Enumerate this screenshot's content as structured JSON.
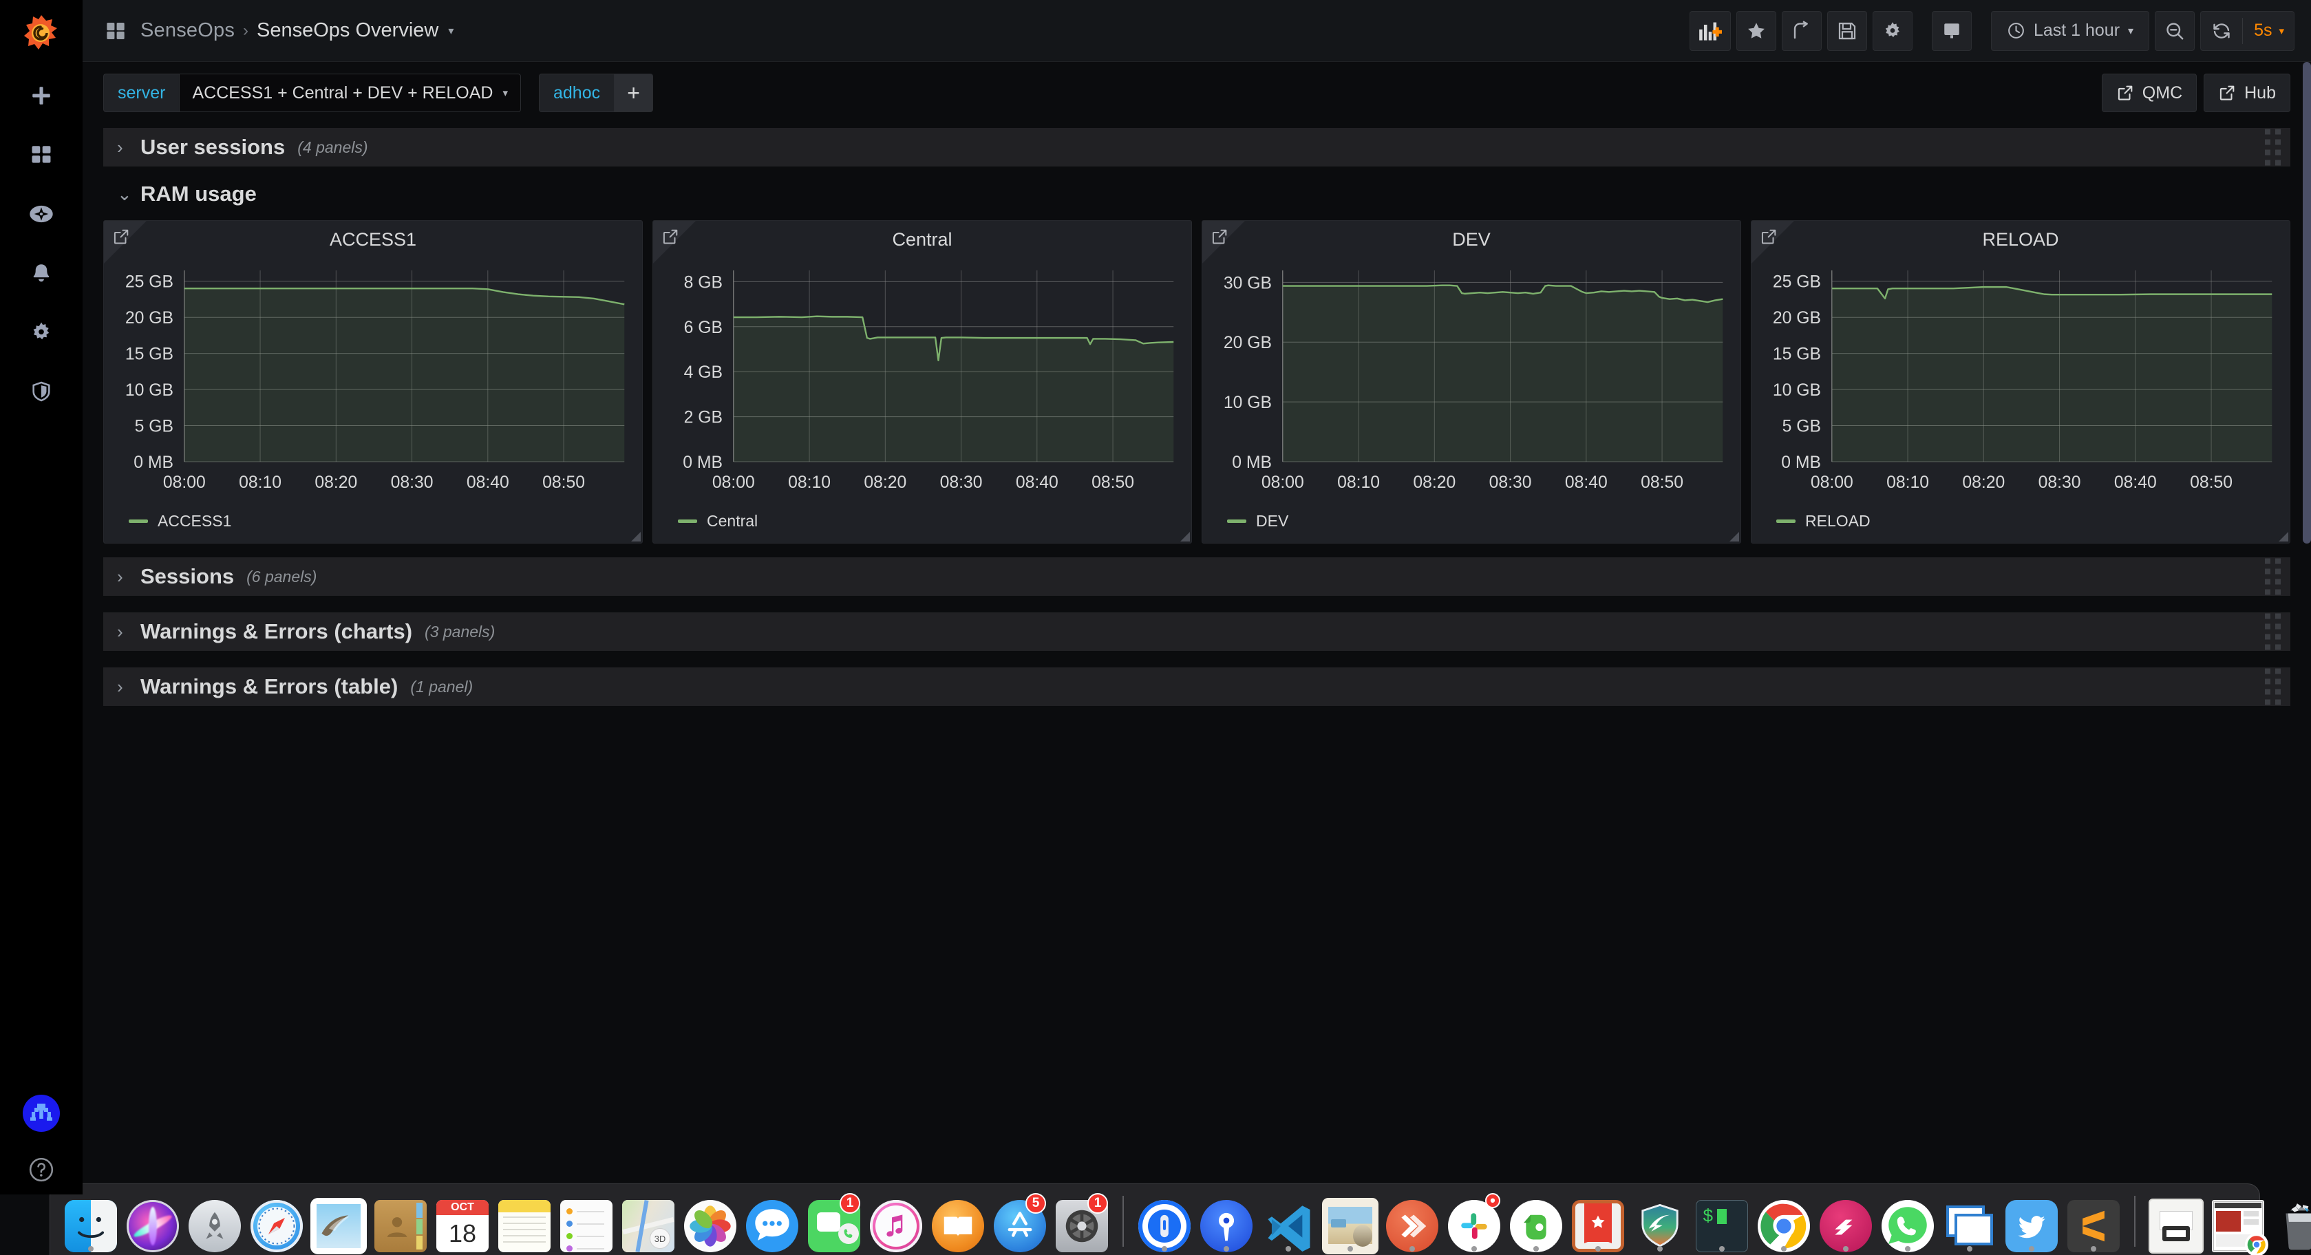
{
  "app": {
    "name": "Grafana",
    "logo_icon": "grafana-logo-icon"
  },
  "sidebar": {
    "items": [
      {
        "name": "create",
        "icon": "plus-icon",
        "label": "Create"
      },
      {
        "name": "dashboards",
        "icon": "dashboards-grid-icon",
        "label": "Dashboards"
      },
      {
        "name": "explore",
        "icon": "compass-icon",
        "label": "Explore"
      },
      {
        "name": "alerting",
        "icon": "bell-icon",
        "label": "Alerting"
      },
      {
        "name": "configuration",
        "icon": "gear-icon",
        "label": "Configuration"
      },
      {
        "name": "server-admin",
        "icon": "shield-icon",
        "label": "Server Admin"
      }
    ],
    "avatar": {
      "icon": "user-avatar-icon",
      "color": "#1a1aee"
    },
    "help": {
      "icon": "question-circle-icon",
      "label": "Help"
    }
  },
  "header": {
    "grid_icon": "dashboard-grid-icon",
    "folder": "SenseOps",
    "separator": "›",
    "title": "SenseOps Overview",
    "caret": "▾",
    "toolbar": [
      {
        "name": "add-panel-button",
        "icon": "add-panel-icon",
        "label": "Add panel"
      },
      {
        "name": "mark-favorite-button",
        "icon": "star-icon",
        "label": "Mark as favorite"
      },
      {
        "name": "share-dashboard-button",
        "icon": "share-icon",
        "label": "Share dashboard"
      },
      {
        "name": "save-dashboard-button",
        "icon": "save-floppy-icon",
        "label": "Save dashboard"
      },
      {
        "name": "dashboard-settings-button",
        "icon": "gear-icon",
        "label": "Dashboard settings"
      },
      {
        "name": "cycle-view-mode-button",
        "icon": "tv-monitor-icon",
        "label": "Cycle view mode"
      }
    ],
    "time_picker": {
      "icon": "clock-icon",
      "label": "Last 1 hour",
      "caret": "▾"
    },
    "zoom_out": {
      "icon": "zoom-out-magnifier-icon",
      "label": "Zoom out time range"
    },
    "refresh": {
      "icon": "refresh-circular-arrows-icon",
      "interval": "5s",
      "caret": "▾",
      "color": "#ff8800"
    }
  },
  "submenu": {
    "variables": [
      {
        "name": "server",
        "label": "server",
        "value": "ACCESS1 + Central + DEV + RELOAD",
        "caret": "▾"
      },
      {
        "name": "adhoc",
        "label": "adhoc",
        "add_label": "+"
      }
    ],
    "links": [
      {
        "name": "qmc-link",
        "label": "QMC",
        "icon": "external-link-icon"
      },
      {
        "name": "hub-link",
        "label": "Hub",
        "icon": "external-link-icon"
      }
    ],
    "label_color": "#33b5e5"
  },
  "rows": [
    {
      "name": "user-sessions",
      "title": "User sessions",
      "count": "(4 panels)",
      "collapsed": true,
      "chevron": "›"
    },
    {
      "name": "ram-usage",
      "title": "RAM usage",
      "count": "",
      "collapsed": false,
      "chevron": "⌄"
    },
    {
      "name": "sessions",
      "title": "Sessions",
      "count": "(6 panels)",
      "collapsed": true,
      "chevron": "›"
    },
    {
      "name": "warnings-errors-charts",
      "title": "Warnings & Errors (charts)",
      "count": "(3 panels)",
      "collapsed": true,
      "chevron": "›"
    },
    {
      "name": "warnings-errors-table",
      "title": "Warnings & Errors (table)",
      "count": "(1 panel)",
      "collapsed": true,
      "chevron": "›"
    }
  ],
  "chart_data": [
    {
      "type": "line",
      "panel_name": "access1-ram-panel",
      "title": "ACCESS1",
      "xlabel": "",
      "ylabel": "",
      "legend": [
        "ACCESS1"
      ],
      "legend_position": "bottom",
      "grid": true,
      "line_color": "#7eb26d",
      "fill_color": "rgba(126,178,109,0.12)",
      "ytick_labels": [
        "0 MB",
        "5 GB",
        "10 GB",
        "15 GB",
        "20 GB",
        "25 GB"
      ],
      "ytick_values": [
        0,
        5,
        10,
        15,
        20,
        25
      ],
      "ylim": [
        0,
        26.5
      ],
      "xtick_labels": [
        "08:00",
        "08:10",
        "08:20",
        "08:30",
        "08:40",
        "08:50"
      ],
      "x": [
        0,
        4,
        8,
        12,
        16,
        20,
        24,
        28,
        32,
        36,
        38,
        40,
        42,
        44,
        46,
        48,
        50,
        52,
        54,
        56,
        58
      ],
      "values": [
        24.0,
        24.0,
        24.0,
        24.0,
        24.0,
        24.0,
        24.0,
        24.0,
        24.0,
        24.0,
        24.0,
        23.9,
        23.5,
        23.2,
        23.0,
        22.9,
        22.85,
        22.8,
        22.6,
        22.2,
        21.8
      ]
    },
    {
      "type": "line",
      "panel_name": "central-ram-panel",
      "title": "Central",
      "xlabel": "",
      "ylabel": "",
      "legend": [
        "Central"
      ],
      "legend_position": "bottom",
      "grid": true,
      "line_color": "#7eb26d",
      "fill_color": "rgba(126,178,109,0.12)",
      "ytick_labels": [
        "0 MB",
        "2 GB",
        "4 GB",
        "6 GB",
        "8 GB"
      ],
      "ytick_values": [
        0,
        2,
        4,
        6,
        8
      ],
      "ylim": [
        0,
        8.5
      ],
      "xtick_labels": [
        "08:00",
        "08:10",
        "08:20",
        "08:30",
        "08:40",
        "08:50"
      ],
      "x": [
        0,
        3,
        6,
        9,
        11,
        13,
        15,
        17,
        17.6,
        18,
        19,
        21,
        23,
        25,
        26.6,
        27,
        27.4,
        28,
        30,
        33,
        36,
        39,
        42,
        45,
        46.6,
        47,
        47.4,
        49,
        51,
        53,
        54,
        55,
        56,
        58
      ],
      "values": [
        6.42,
        6.42,
        6.44,
        6.42,
        6.46,
        6.44,
        6.44,
        6.42,
        5.5,
        5.46,
        5.52,
        5.52,
        5.52,
        5.52,
        5.52,
        4.5,
        5.5,
        5.52,
        5.52,
        5.5,
        5.5,
        5.5,
        5.5,
        5.5,
        5.5,
        5.22,
        5.46,
        5.46,
        5.44,
        5.4,
        5.25,
        5.28,
        5.3,
        5.32
      ]
    },
    {
      "type": "line",
      "panel_name": "dev-ram-panel",
      "title": "DEV",
      "xlabel": "",
      "ylabel": "",
      "legend": [
        "DEV"
      ],
      "legend_position": "bottom",
      "grid": true,
      "line_color": "#7eb26d",
      "fill_color": "rgba(126,178,109,0.12)",
      "ytick_labels": [
        "0 MB",
        "10 GB",
        "20 GB",
        "30 GB"
      ],
      "ytick_values": [
        0,
        10,
        20,
        30
      ],
      "ylim": [
        0,
        32
      ],
      "xtick_labels": [
        "08:00",
        "08:10",
        "08:20",
        "08:30",
        "08:40",
        "08:50"
      ],
      "x": [
        0,
        5,
        10,
        15,
        19,
        21,
        22,
        23,
        23.6,
        24,
        25,
        26,
        27,
        28,
        29,
        30,
        31,
        32,
        33,
        34,
        34.6,
        35,
        36,
        38,
        39.5,
        40,
        41,
        42,
        43,
        44,
        45,
        46,
        47,
        48,
        49,
        49.6,
        50,
        51,
        52,
        53,
        54,
        55,
        56,
        57,
        58
      ],
      "values": [
        29.4,
        29.4,
        29.4,
        29.4,
        29.4,
        29.5,
        29.5,
        29.4,
        28.2,
        28.1,
        28.2,
        28.3,
        28.2,
        28.3,
        28.4,
        28.3,
        28.2,
        28.3,
        28.1,
        28.3,
        29.4,
        29.5,
        29.4,
        29.4,
        28.4,
        28.2,
        28.3,
        28.5,
        28.4,
        28.5,
        28.6,
        28.5,
        28.6,
        28.5,
        28.4,
        27.6,
        27.4,
        27.2,
        27.3,
        27.0,
        27.1,
        26.9,
        26.7,
        27.0,
        27.2
      ]
    },
    {
      "type": "line",
      "panel_name": "reload-ram-panel",
      "title": "RELOAD",
      "xlabel": "",
      "ylabel": "",
      "legend": [
        "RELOAD"
      ],
      "legend_position": "bottom",
      "grid": true,
      "line_color": "#7eb26d",
      "fill_color": "rgba(126,178,109,0.12)",
      "ytick_labels": [
        "0 MB",
        "5 GB",
        "10 GB",
        "15 GB",
        "20 GB",
        "25 GB"
      ],
      "ytick_values": [
        0,
        5,
        10,
        15,
        20,
        25
      ],
      "ylim": [
        0,
        26.5
      ],
      "xtick_labels": [
        "08:00",
        "08:10",
        "08:20",
        "08:30",
        "08:40",
        "08:50"
      ],
      "x": [
        0,
        3,
        6,
        7,
        7.4,
        8,
        10,
        13,
        16,
        18,
        20,
        22,
        23,
        24,
        25,
        26,
        27,
        28,
        29,
        31,
        34,
        38,
        42,
        46,
        50,
        54,
        58
      ],
      "values": [
        24.0,
        24.0,
        24.0,
        22.6,
        23.9,
        24.0,
        24.0,
        24.0,
        24.0,
        24.1,
        24.2,
        24.2,
        24.2,
        24.0,
        23.8,
        23.6,
        23.4,
        23.2,
        23.15,
        23.15,
        23.15,
        23.15,
        23.2,
        23.2,
        23.2,
        23.2,
        23.2
      ]
    }
  ],
  "dock": {
    "items": [
      {
        "name": "finder",
        "label": "Finder",
        "running": true
      },
      {
        "name": "siri",
        "label": "Siri",
        "running": false
      },
      {
        "name": "launchpad",
        "label": "Launchpad",
        "running": false
      },
      {
        "name": "safari",
        "label": "Safari",
        "running": false
      },
      {
        "name": "mail",
        "label": "Mail",
        "running": false
      },
      {
        "name": "contacts",
        "label": "Contacts",
        "running": false
      },
      {
        "name": "calendar",
        "label": "Calendar",
        "running": false,
        "month": "OCT",
        "day": "18"
      },
      {
        "name": "notes",
        "label": "Notes",
        "running": false
      },
      {
        "name": "reminders",
        "label": "Reminders",
        "running": false
      },
      {
        "name": "maps",
        "label": "Maps",
        "running": false
      },
      {
        "name": "photos",
        "label": "Photos",
        "running": false
      },
      {
        "name": "messages",
        "label": "Messages",
        "running": false
      },
      {
        "name": "facetime",
        "label": "FaceTime",
        "running": false,
        "badge": "1"
      },
      {
        "name": "itunes",
        "label": "iTunes",
        "running": false
      },
      {
        "name": "ibooks",
        "label": "iBooks",
        "running": false
      },
      {
        "name": "app-store",
        "label": "App Store",
        "running": false,
        "badge": "5"
      },
      {
        "name": "system-preferences",
        "label": "System Preferences",
        "running": false,
        "badge": "1"
      },
      {
        "name": "separator-1",
        "label": "",
        "separator": true
      },
      {
        "name": "1password",
        "label": "1Password",
        "running": true
      },
      {
        "name": "keychain",
        "label": "Keys",
        "running": true
      },
      {
        "name": "visual-studio-code",
        "label": "Visual Studio Code",
        "running": true
      },
      {
        "name": "preview",
        "label": "Preview",
        "running": true
      },
      {
        "name": "remote-desktop",
        "label": "Microsoft Remote Desktop",
        "running": true
      },
      {
        "name": "slack",
        "label": "Slack",
        "running": true,
        "badge": "•"
      },
      {
        "name": "evernote",
        "label": "Evernote",
        "running": true
      },
      {
        "name": "wunderlist",
        "label": "Wunderlist",
        "running": true
      },
      {
        "name": "bitdefender",
        "label": "Security",
        "running": true
      },
      {
        "name": "terminal",
        "label": "Terminal",
        "running": true
      },
      {
        "name": "google-chrome",
        "label": "Google Chrome",
        "running": true
      },
      {
        "name": "postman",
        "label": "Postman",
        "running": true
      },
      {
        "name": "whatsapp",
        "label": "WhatsApp",
        "running": true
      },
      {
        "name": "screens",
        "label": "Screens",
        "running": true
      },
      {
        "name": "twitter",
        "label": "Twitter",
        "running": true
      },
      {
        "name": "sublime-text",
        "label": "Sublime Text",
        "running": true
      },
      {
        "name": "separator-2",
        "label": "",
        "separator": true
      },
      {
        "name": "downloads-stack",
        "label": "Downloads",
        "running": false
      },
      {
        "name": "minimized-chrome-window",
        "label": "Chrome Window",
        "running": false
      },
      {
        "name": "trash",
        "label": "Trash",
        "running": false
      }
    ]
  }
}
